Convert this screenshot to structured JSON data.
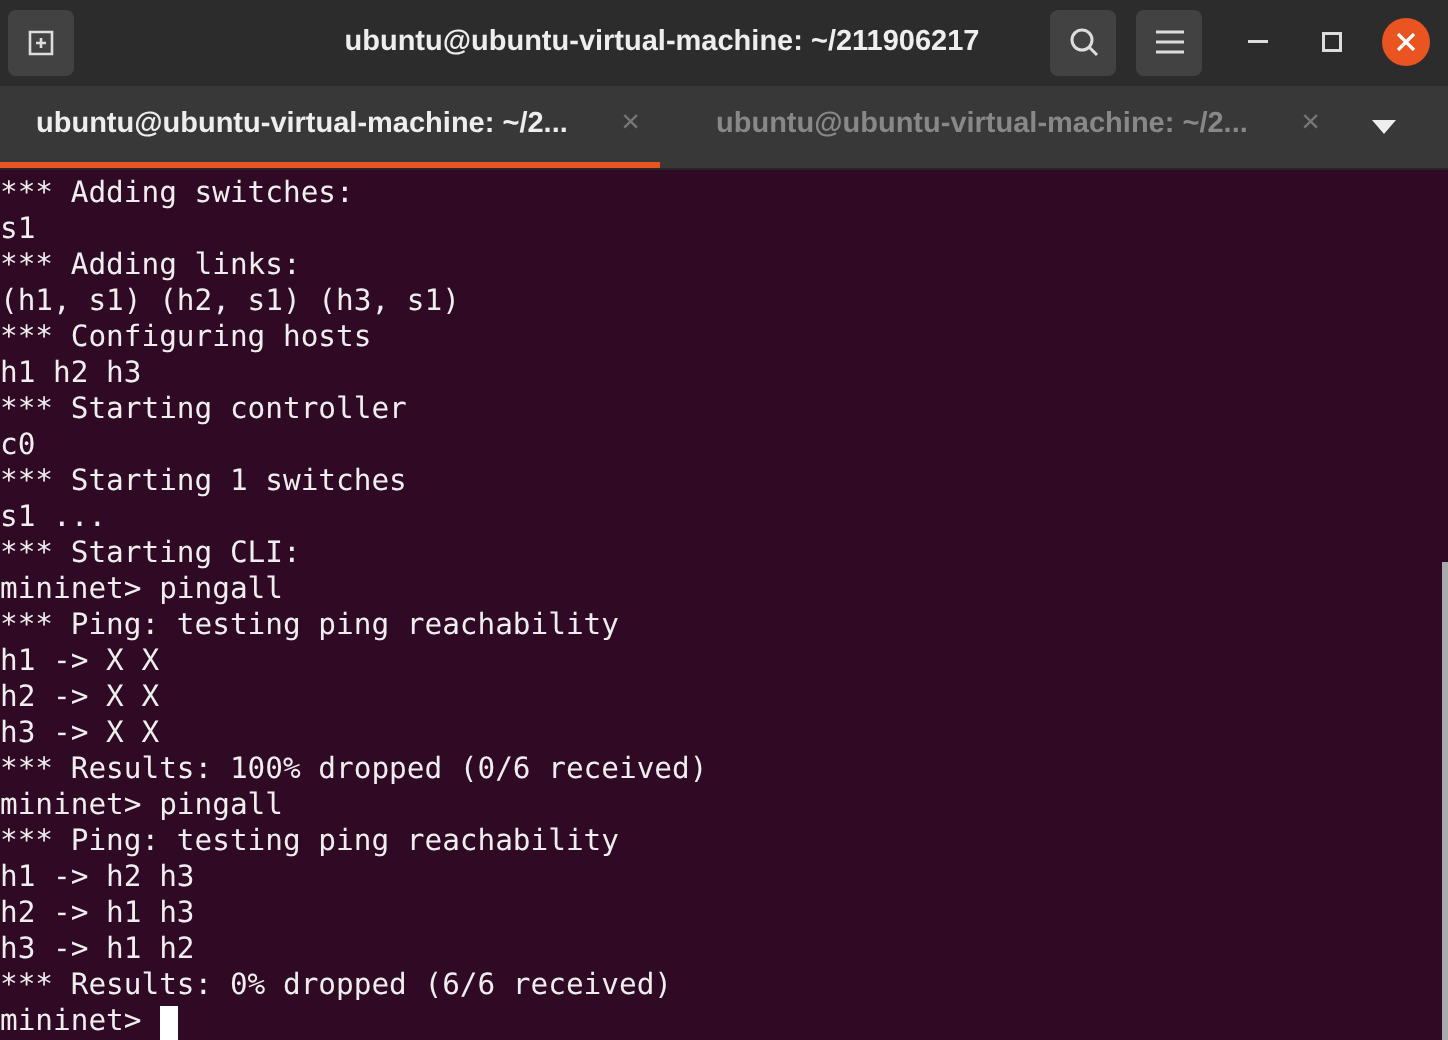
{
  "window": {
    "title": "ubuntu@ubuntu-virtual-machine: ~/211906217"
  },
  "tabs": [
    {
      "label": "ubuntu@ubuntu-virtual-machine: ~/2...",
      "selected": true,
      "close": "×"
    },
    {
      "label": "ubuntu@ubuntu-virtual-machine: ~/2...",
      "selected": false,
      "close": "×"
    }
  ],
  "terminal": {
    "lines": [
      "*** Adding switches:",
      "s1",
      "*** Adding links:",
      "(h1, s1) (h2, s1) (h3, s1)",
      "*** Configuring hosts",
      "h1 h2 h3",
      "*** Starting controller",
      "c0",
      "*** Starting 1 switches",
      "s1 ...",
      "*** Starting CLI:",
      "mininet> pingall",
      "*** Ping: testing ping reachability",
      "h1 -> X X",
      "h2 -> X X",
      "h3 -> X X",
      "*** Results: 100% dropped (0/6 received)",
      "mininet> pingall",
      "*** Ping: testing ping reachability",
      "h1 -> h2 h3",
      "h2 -> h1 h3",
      "h3 -> h1 h2",
      "*** Results: 0% dropped (6/6 received)"
    ],
    "prompt": "mininet>",
    "cursor": true
  }
}
